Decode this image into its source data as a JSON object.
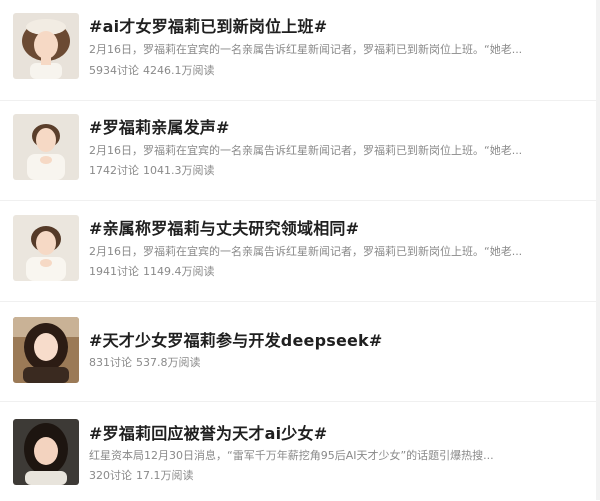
{
  "items": [
    {
      "title": "#ai才女罗福莉已到新岗位上班#",
      "desc": "2月16日，罗福莉在宜宾的一名亲属告诉红星新闻记者，罗福莉已到新岗位上班。“她老...",
      "discussions": "5934讨论",
      "reads": "4246.1万阅读"
    },
    {
      "title": "#罗福莉亲属发声#",
      "desc": "2月16日，罗福莉在宜宾的一名亲属告诉红星新闻记者，罗福莉已到新岗位上班。“她老...",
      "discussions": "1742讨论",
      "reads": "1041.3万阅读"
    },
    {
      "title": "#亲属称罗福莉与丈夫研究领域相同#",
      "desc": "2月16日，罗福莉在宜宾的一名亲属告诉红星新闻记者，罗福莉已到新岗位上班。“她老...",
      "discussions": "1941讨论",
      "reads": "1149.4万阅读"
    },
    {
      "title": "#天才少女罗福莉参与开发deepseek#",
      "desc": "",
      "discussions": "831讨论",
      "reads": "537.8万阅读"
    },
    {
      "title": "#罗福莉回应被誉为天才ai少女#",
      "desc": "红星资本局12月30日消息，“雷军千万年薪挖角95后AI天才少女”的话题引爆热搜...",
      "discussions": "320讨论",
      "reads": "17.1万阅读"
    }
  ]
}
